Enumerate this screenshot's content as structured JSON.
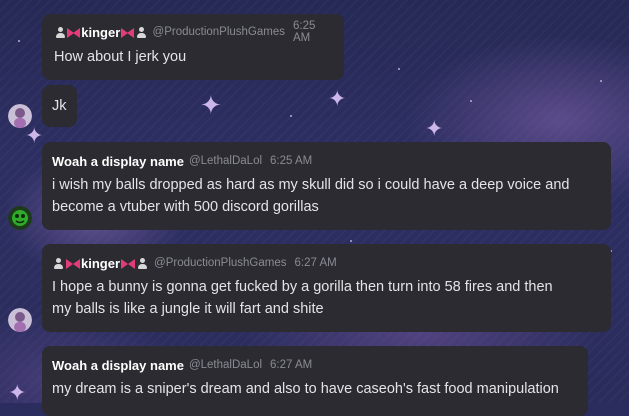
{
  "messages": [
    {
      "username": "kinger",
      "handle": "@ProductionPlushGames",
      "time": "6:25 AM",
      "lines": [
        "How about I jerk you"
      ]
    },
    {
      "lines": [
        "Jk"
      ]
    },
    {
      "username": "Woah a display name",
      "handle": "@LethalDaLol",
      "time": "6:25 AM",
      "lines": [
        "i wish my balls dropped as hard as my skull did so i could have a deep voice and",
        "become a vtuber with 500 discord gorillas"
      ]
    },
    {
      "username": "kinger",
      "handle": "@ProductionPlushGames",
      "time": "6:27 AM",
      "lines": [
        "I hope a bunny is gonna get fucked by a gorilla then turn into 58 fires and then",
        "my balls is like a jungle it will fart and shite"
      ]
    },
    {
      "username": "Woah a display name",
      "handle": "@LethalDaLol",
      "time": "6:27 AM",
      "lines": [
        "my dream is a sniper's dream and also to have caseoh's fast food manipulation"
      ]
    }
  ],
  "icons": {
    "bow": "pink-bow-icon",
    "person": "person-icon"
  },
  "colors": {
    "bubble": "#2b2b31",
    "bow": "#e23c7a",
    "background": "#2b2d5f"
  }
}
